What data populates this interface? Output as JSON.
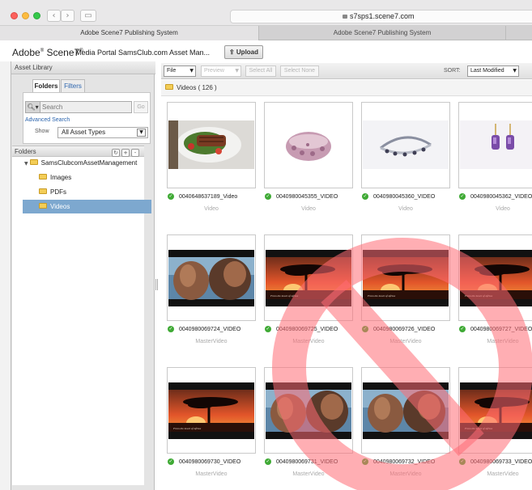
{
  "browser": {
    "url": "s7sps1.scene7.com",
    "tabs": [
      "Adobe Scene7 Publishing System",
      "Adobe Scene7 Publishing System"
    ]
  },
  "app": {
    "brand": "Adobe",
    "brand_product": "Scene7",
    "portal": "Media Portal",
    "client": "SamsClub.com Asset Man...",
    "upload_label": "Upload"
  },
  "library": {
    "title": "Asset Library",
    "tabs": [
      "Folders",
      "Filters"
    ],
    "search_placeholder": "Search",
    "go_label": "Go",
    "advanced_search": "Advanced Search",
    "show_label": "Show",
    "show_value": "All Asset Types",
    "folders_header": "Folders",
    "tree": {
      "root": "SamsClubcomAssetManagement",
      "children": [
        "Images",
        "PDFs",
        "Videos"
      ],
      "selected": "Videos"
    }
  },
  "toolbar": {
    "file": "File",
    "preview": "Preview",
    "select_all": "Select All",
    "select_none": "Select None",
    "sort_label": "SORT:",
    "sort_value": "Last Modified"
  },
  "path": {
    "folder": "Videos",
    "count": "( 126 )"
  },
  "assets": [
    {
      "name": "0040648637189_Video",
      "type": "Video",
      "thumb": "food"
    },
    {
      "name": "0040980045355_VIDEO",
      "type": "Video",
      "thumb": "bracelet-pink"
    },
    {
      "name": "0040980045360_VIDEO",
      "type": "Video",
      "thumb": "bracelet-silver"
    },
    {
      "name": "0040980045362_VIDEO",
      "type": "Video",
      "thumb": "earrings"
    },
    {
      "name": "0040980069724_VIDEO",
      "type": "MasterVideo",
      "thumb": "couple"
    },
    {
      "name": "0040980069725_VIDEO",
      "type": "MasterVideo",
      "thumb": "sunset"
    },
    {
      "name": "0040980069726_VIDEO",
      "type": "MasterVideo",
      "thumb": "sunset"
    },
    {
      "name": "0040980069727_VIDEO",
      "type": "MasterVideo",
      "thumb": "sunset"
    },
    {
      "name": "0040980069730_VIDEO",
      "type": "MasterVideo",
      "thumb": "sunset"
    },
    {
      "name": "0040980069731_VIDEO",
      "type": "MasterVideo",
      "thumb": "couple"
    },
    {
      "name": "0040980069732_VIDEO",
      "type": "MasterVideo",
      "thumb": "couple"
    },
    {
      "name": "0040980069733_VIDEO",
      "type": "MasterVideo",
      "thumb": "sunset"
    }
  ],
  "thumb_caption": "From the heart of Africa",
  "colors": {
    "selected_folder": "#7da8cf",
    "link": "#2b64ad",
    "check": "#3faa35",
    "prohibition": "#ff6b75"
  }
}
